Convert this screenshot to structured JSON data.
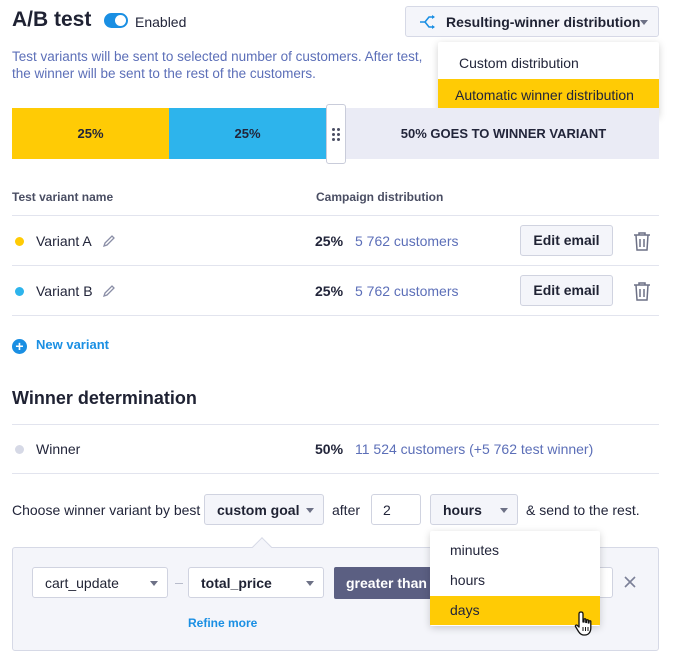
{
  "header": {
    "title": "A/B test",
    "enabled_label": "Enabled",
    "distribution_select": "Resulting-winner distribution",
    "description": "Test variants will be sent to selected number of customers. After test, the winner will be sent to the rest of the customers."
  },
  "distribution_menu": {
    "items": [
      "Custom distribution",
      "Automatic winner distribution"
    ],
    "selected": "Automatic winner distribution"
  },
  "bar": {
    "segments": [
      {
        "label": "25%",
        "value": 25,
        "color": "#ffcb05"
      },
      {
        "label": "25%",
        "value": 25,
        "color": "#2db4ec"
      },
      {
        "label": "50% GOES TO WINNER VARIANT",
        "value": 50,
        "color": "#eaebf5"
      }
    ]
  },
  "table": {
    "col_name": "Test variant name",
    "col_dist": "Campaign distribution",
    "rows": [
      {
        "name": "Variant A",
        "pct": "25%",
        "customers": "5 762 customers",
        "button": "Edit email",
        "color": "#ffcb05"
      },
      {
        "name": "Variant B",
        "pct": "25%",
        "customers": "5 762 customers",
        "button": "Edit email",
        "color": "#2db4ec"
      }
    ],
    "new_variant": "New variant"
  },
  "winner": {
    "section_title": "Winner determination",
    "name": "Winner",
    "pct": "50%",
    "customers": "11 524 customers (+5 762 test winner)",
    "color": "#d6d9e6"
  },
  "choose": {
    "prefix": "Choose winner variant by best",
    "goal": "custom goal",
    "after": "after",
    "amount": "2",
    "unit": "hours",
    "suffix": "& send to the rest."
  },
  "filter": {
    "event": "cart_update",
    "property": "total_price",
    "operator": "greater than",
    "refine": "Refine more"
  },
  "unit_menu": {
    "items": [
      "minutes",
      "hours",
      "days"
    ],
    "selected": "days"
  },
  "colors": {
    "accent": "#1a8fe3",
    "highlight": "#ffcb05",
    "operator": "#5b5f82"
  }
}
